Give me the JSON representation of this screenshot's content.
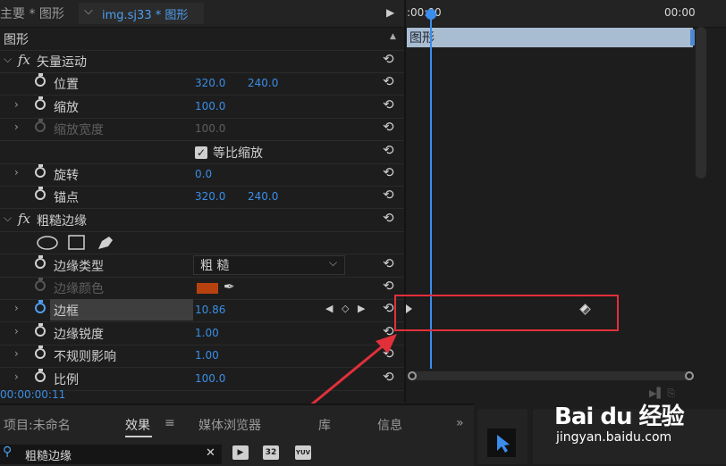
{
  "header": {
    "master_tab": "主要 * 图形",
    "clip_tab": "img.sj33 * 图形",
    "play_icon": "play-triangle"
  },
  "section_title": "图形",
  "properties": [
    {
      "kind": "group",
      "label": "矢量运动"
    },
    {
      "kind": "prop",
      "label": "位置",
      "values": [
        "320.0",
        "240.0"
      ]
    },
    {
      "kind": "prop",
      "label": "缩放",
      "values": [
        "100.0"
      ]
    },
    {
      "kind": "prop",
      "label": "缩放宽度",
      "values": [
        "100.0"
      ],
      "disabled": true
    },
    {
      "kind": "checkbox",
      "label": "等比缩放",
      "checked": true
    },
    {
      "kind": "prop",
      "label": "旋转",
      "values": [
        "0.0"
      ]
    },
    {
      "kind": "prop",
      "label": "锚点",
      "values": [
        "320.0",
        "240.0"
      ]
    },
    {
      "kind": "group",
      "label": "粗糙边缘"
    },
    {
      "kind": "masks",
      "icons": [
        "ellipse-mask-icon",
        "rectangle-mask-icon",
        "pen-mask-icon"
      ]
    },
    {
      "kind": "dropdown",
      "label": "边缘类型",
      "value": "粗 糙"
    },
    {
      "kind": "color",
      "label": "边缘颜色",
      "color": "#b8420f",
      "disabled": true
    },
    {
      "kind": "prop",
      "label": "边框",
      "values": [
        "10.86"
      ],
      "selected": true,
      "keyframed": true
    },
    {
      "kind": "prop",
      "label": "边缘锐度",
      "values": [
        "1.00"
      ]
    },
    {
      "kind": "prop",
      "label": "不规则影响",
      "values": [
        "1.00"
      ]
    },
    {
      "kind": "prop",
      "label": "比例",
      "values": [
        "100.0"
      ]
    }
  ],
  "timeline": {
    "start_time": ":00:00",
    "end_time": "00:00",
    "clip_label": "图形",
    "current_timecode": "00:00:00:11"
  },
  "bottom_panel": {
    "tabs": [
      "项目:未命名",
      "效果",
      "媒体浏览器",
      "库",
      "信息"
    ],
    "effects_menu_icon": "≡",
    "overflow": "»",
    "search_value": "粗糙边缘",
    "badges": [
      "32",
      "YUV"
    ]
  },
  "watermark": {
    "logo": "Bai du 经验",
    "url": "jingyan.baidu.com"
  },
  "colors": {
    "accent_blue": "#3a8ee6",
    "highlight_red": "#e2303a",
    "clip_fill": "#a9bdd2",
    "edge_color": "#b8420f"
  }
}
